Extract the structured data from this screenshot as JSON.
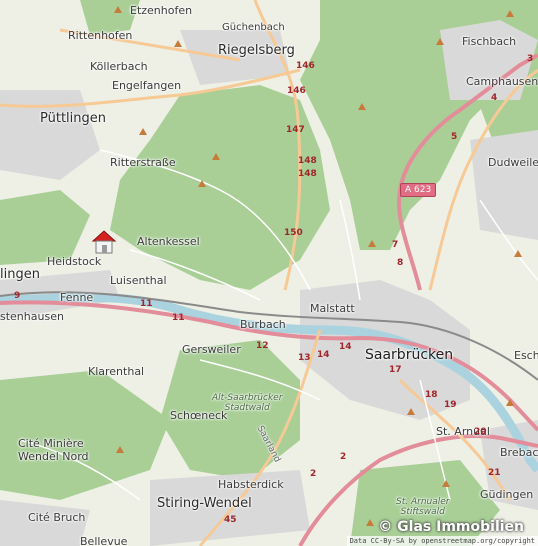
{
  "colors": {
    "background": "#eef0e6",
    "forest": "#a9cf97",
    "urban": "#d9d9d9",
    "road_major": "#f6c995",
    "road_primary": "#fbdcb0",
    "motorway": "#e28d99",
    "railway": "#8a8a8a",
    "river": "#aad3df",
    "peak": "#c77b3a"
  },
  "places": {
    "etzenhofen": "Etzenhofen",
    "guechenbach": "Güchenbach",
    "riegelsberg": "Riegelsberg",
    "fischbach": "Fischbach",
    "rittenhofen": "Rittenhofen",
    "koellerbach": "Köllerbach",
    "camphausen": "Camphausen",
    "engelfangen": "Engelfangen",
    "puettlingen": "Püttlingen",
    "dudweiler": "Dudweiler",
    "ritterstrasse": "Ritterstraße",
    "altenkessel": "Altenkessel",
    "heidstock": "Heidstock",
    "lingen": "lingen",
    "luisenthal": "Luisenthal",
    "fenne": "Fenne",
    "stenhausen": "stenhausen",
    "malstatt": "Malstatt",
    "burbach": "Burbach",
    "gersweiler": "Gersweiler",
    "saarbruecken": "Saarbrücken",
    "esch": "Esch",
    "klarenthal": "Klarenthal",
    "alt_saarbruecker": "Alt-Saarbrücker\nStadtwald",
    "schoeneck": "Schœneck",
    "cite_miniere": "Cité Minière\nWendel Nord",
    "st_arnual": "St. Arnual",
    "brebach": "Brebach",
    "saarland": "Saarland",
    "habsterdick": "Habsterdick",
    "stiring_wendel": "Stiring-Wendel",
    "gudingen": "Güdingen",
    "st_arnualer": "St. Arnualer\nStiftswald",
    "cite_bruch": "Cité Bruch",
    "bellevue": "Bellevue"
  },
  "road_numbers": {
    "a623": "A 623",
    "r146a": "146",
    "r146b": "146",
    "r147": "147",
    "r148a": "148",
    "r148b": "148",
    "r150": "150",
    "r11a": "11",
    "r11b": "11",
    "r12": "12",
    "r13": "13",
    "r14a": "14",
    "r14b": "14",
    "r9": "9",
    "r2a": "2",
    "r2b": "2",
    "r45": "45",
    "r3": "3",
    "r4": "4",
    "r5": "5",
    "r7": "7",
    "r8": "8",
    "r17": "17",
    "r18": "18",
    "r19": "19",
    "r20": "20",
    "r21": "21"
  },
  "marker_icon": "house-icon",
  "watermark": "© Glas Immobilien",
  "attribution": "Data CC-By-SA by openstreetmap.org/copyright"
}
